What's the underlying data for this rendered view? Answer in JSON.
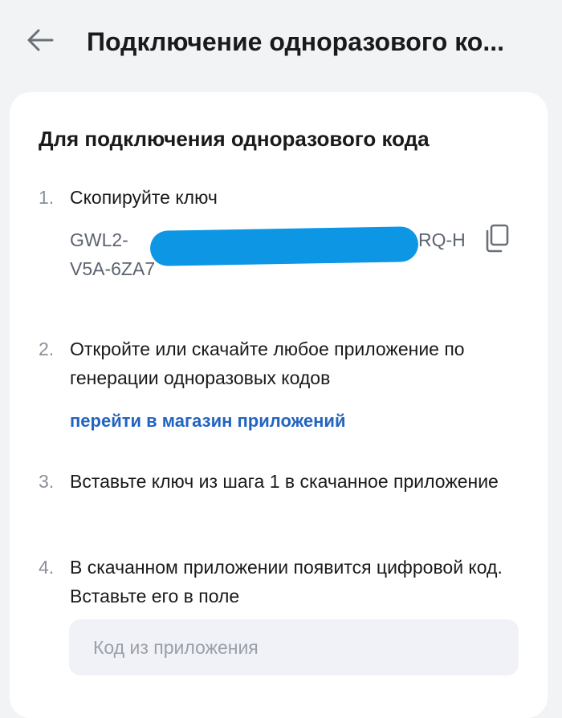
{
  "header": {
    "title": "Подключение одноразового ко...",
    "back_icon": "arrow-left-icon"
  },
  "card": {
    "title": "Для подключения одноразового кода",
    "steps": [
      {
        "number": "1.",
        "text": "Скопируйте ключ"
      },
      {
        "number": "2.",
        "text": "Откройте или скачайте любое приложение по генерации одноразовых кодов"
      },
      {
        "number": "3.",
        "text": "Вставьте ключ из шага 1 в скачанное приложение"
      },
      {
        "number": "4.",
        "text": "В скачанном приложении появится цифровой код. Вставьте его в поле"
      }
    ],
    "key": {
      "line1_start": "GWL2-",
      "line1_end": "RQ-H",
      "line2": "V5A-6ZA7",
      "copy_icon": "copy-icon"
    },
    "store_link": "перейти в магазин приложений",
    "code_input": {
      "placeholder": "Код из приложения",
      "value": ""
    }
  },
  "colors": {
    "background": "#f2f3f5",
    "card": "#ffffff",
    "link": "#2264c1",
    "redaction": "#0c96e4",
    "muted": "#8a8f98"
  }
}
